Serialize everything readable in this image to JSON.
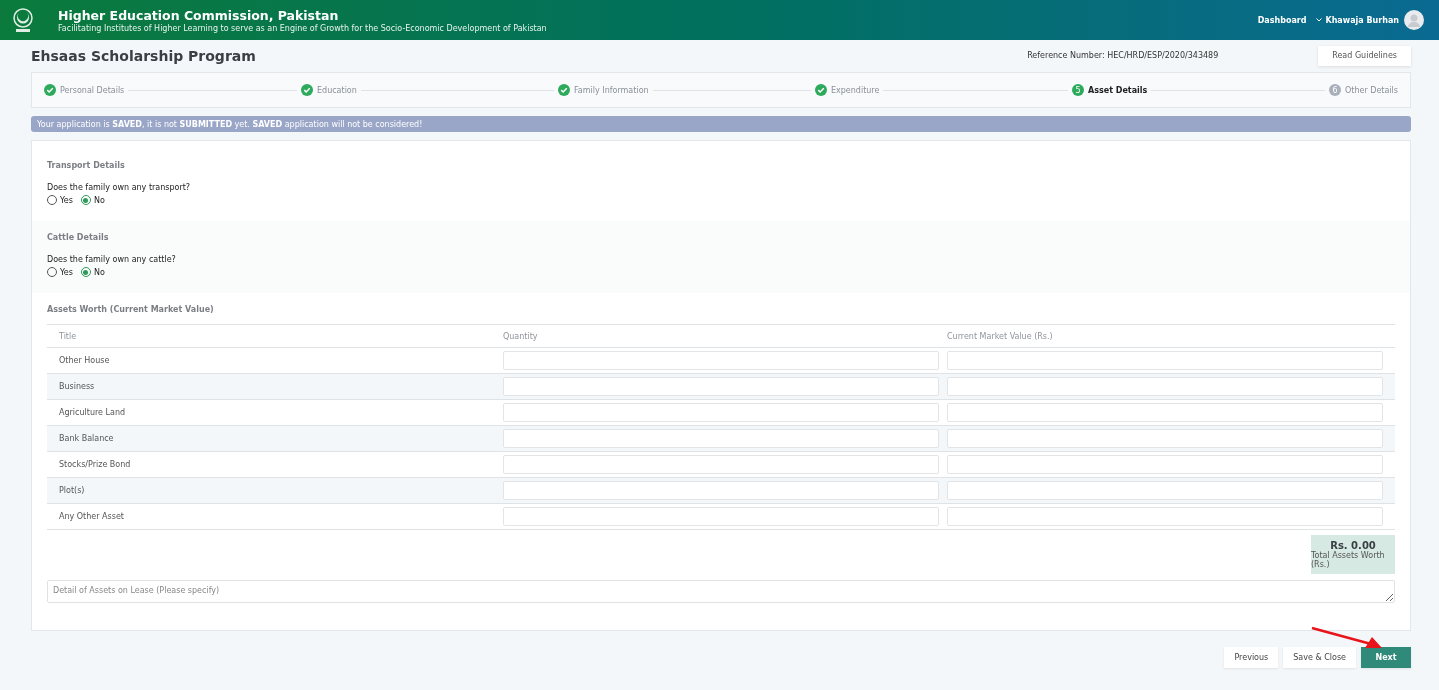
{
  "header": {
    "title": "Higher Education Commission, Pakistan",
    "subtitle": "Facilitating Institutes of Higher Learning to serve as an Engine of Growth for the Socio-Economic Development of Pakistan",
    "nav_link": "Dashboard",
    "user_name": "Khawaja Burhan"
  },
  "page": {
    "title": "Ehsaas Scholarship Program",
    "reference": "Reference Number: HEC/HRD/ESP/2020/343489",
    "guidelines_button": "Read Guidelines"
  },
  "steps": [
    {
      "label": "Personal Details",
      "completed": true,
      "selected": false
    },
    {
      "label": "Education",
      "completed": true,
      "selected": false
    },
    {
      "label": "Family Information",
      "completed": true,
      "selected": false
    },
    {
      "label": "Expenditure",
      "completed": true,
      "selected": false
    },
    {
      "label": "Asset Details",
      "completed": false,
      "selected": true,
      "number": "5"
    },
    {
      "label": "Other Details",
      "completed": false,
      "selected": false,
      "number": "6"
    }
  ],
  "alert": "Your application is **SAVED**, it is not **SUBMITTED** yet. **SAVED** application will not be considered!",
  "sections": [
    {
      "title": "Transport Details",
      "question": "Does the family own any transport?",
      "options": [
        {
          "label": "Yes",
          "selected": false
        },
        {
          "label": "No",
          "selected": true
        }
      ]
    },
    {
      "title": "Cattle Details",
      "question": "Does the family own any cattle?",
      "options": [
        {
          "label": "Yes",
          "selected": false
        },
        {
          "label": "No",
          "selected": true
        }
      ]
    }
  ],
  "assets": {
    "title": "Assets Worth (Current Market Value)",
    "columns": [
      "Title",
      "Quantity",
      "Current Market Value (Rs.)"
    ],
    "rows": [
      "Other House",
      "Business",
      "Agriculture Land",
      "Bank Balance",
      "Stocks/Prize Bond",
      "Plot(s)",
      "Any Other Asset"
    ],
    "total_value": "Rs. 0.00",
    "total_label": "Total Assets Worth (Rs.)",
    "lease_placeholder": "Detail of Assets on Lease (Please specify)"
  },
  "buttons": {
    "previous": "Previous",
    "save": "Save & Close",
    "next": "Next"
  }
}
